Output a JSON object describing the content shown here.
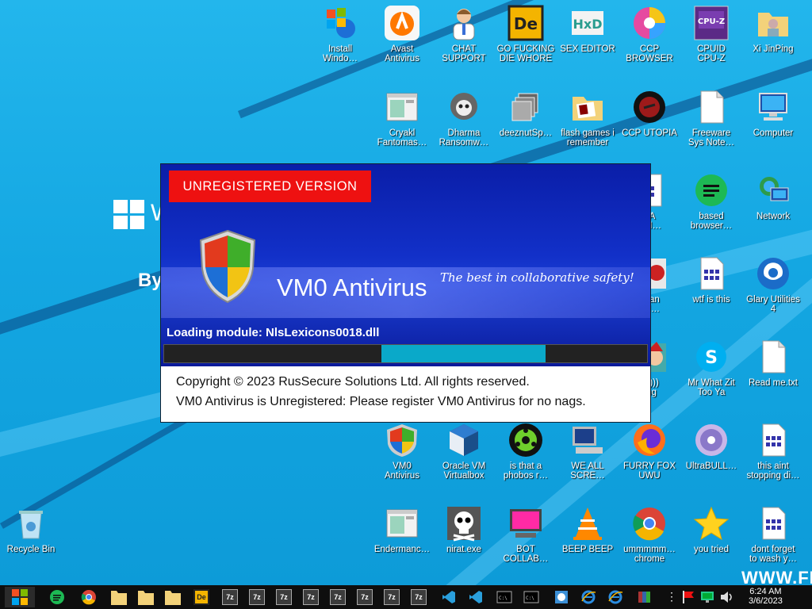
{
  "desktop": {
    "brand_letter": "W",
    "brand_by": "By",
    "url_text": "WWW.FR",
    "icons": [
      {
        "label": "Install\nWindo…",
        "icon": "windows-install-icon"
      },
      {
        "label": "Avast\nAntivirus",
        "icon": "avast-icon"
      },
      {
        "label": "CHAT\nSUPPORT",
        "icon": "chat-support-icon"
      },
      {
        "label": "GO FUCKING\nDIE WHORE",
        "icon": "de-app-icon"
      },
      {
        "label": "SEX EDITOR",
        "icon": "hxd-icon"
      },
      {
        "label": "CCP\nBROWSER",
        "icon": "ccp-browser-icon"
      },
      {
        "label": "CPUID\nCPU-Z",
        "icon": "cpuz-icon"
      },
      {
        "label": "Xi JinPing",
        "icon": "folder-user-icon"
      },
      {
        "label": "Cryakl\nFantomas…",
        "icon": "app-window-icon"
      },
      {
        "label": "Dharma\nRansomw…",
        "icon": "skull-helmet-icon"
      },
      {
        "label": "deeznutSp…",
        "icon": "stacked-pages-icon"
      },
      {
        "label": "flash games i\nremember",
        "icon": "folder-icon"
      },
      {
        "label": "CCP UTOPIA",
        "icon": "ccp-utopia-icon"
      },
      {
        "label": "Freeware\nSys Note…",
        "icon": "text-file-icon"
      },
      {
        "label": "Computer",
        "icon": "computer-icon"
      },
      {
        "label": "YA\nOM…",
        "icon": "doc-partial-icon"
      },
      {
        "label": "based\nbrowser…",
        "icon": "green-chat-icon"
      },
      {
        "label": "Network",
        "icon": "network-icon"
      },
      {
        "label": "ndan\ncid…",
        "icon": "red-app-icon"
      },
      {
        "label": "wtf is this",
        "icon": "ini-file-icon"
      },
      {
        "label": "Glary Utilities\n4",
        "icon": "glary-icon"
      },
      {
        "label": "ey)))\nling",
        "icon": "santa-icon"
      },
      {
        "label": "Mr What Zit\nToo Ya",
        "icon": "skype-icon"
      },
      {
        "label": "Read me.txt",
        "icon": "text-file-icon"
      },
      {
        "label": "VM0\nAntivirus",
        "icon": "shield-icon"
      },
      {
        "label": "Oracle VM\nVirtualbox",
        "icon": "virtualbox-icon"
      },
      {
        "label": "is that a\nphobos r…",
        "icon": "green-virus-icon"
      },
      {
        "label": "WE ALL\nSCRE…",
        "icon": "computer-old-icon"
      },
      {
        "label": "FURRY FOX\nUWU",
        "icon": "firefox-icon"
      },
      {
        "label": "UltraBULL…",
        "icon": "disc-icon"
      },
      {
        "label": "this aint\nstopping di…",
        "icon": "ini-file-icon"
      },
      {
        "label": "Recycle Bin",
        "icon": "recycle-bin-icon"
      },
      {
        "label": "Endermanc…",
        "icon": "app-window-icon"
      },
      {
        "label": "nirat.exe",
        "icon": "skull-icon"
      },
      {
        "label": "BOT\nCOLLAB…",
        "icon": "magenta-monitor-icon"
      },
      {
        "label": "BEEP BEEP",
        "icon": "vlc-icon"
      },
      {
        "label": "ummmmm…\nchrome",
        "icon": "chrome-icon"
      },
      {
        "label": "you tried",
        "icon": "star-icon"
      },
      {
        "label": "dont forget\nto wash y…",
        "icon": "ini-file-icon"
      }
    ]
  },
  "splash": {
    "badge": "UNREGISTERED VERSION",
    "product": "VM0 Antivirus",
    "tagline": "The best in collaborative safety!",
    "loading": "Loading module: NlsLexicons0018.dll",
    "progress_start": 0.45,
    "progress_end": 0.79,
    "copyright": "Copyright © 2023 RusSecure Solutions Ltd. All rights reserved.",
    "unregistered_note": "VM0 Antivirus is Unregistered: Please register VM0 Antivirus for no nags."
  },
  "taskbar": {
    "time": "6:24 AM",
    "date": "3/6/2023",
    "seven_zip_label": "7z",
    "de_label": "De",
    "items": [
      "start",
      "spotify",
      "chrome",
      "folder",
      "folder",
      "folder",
      "de",
      "7z",
      "7z",
      "7z",
      "7z",
      "7z",
      "7z",
      "7z",
      "7z",
      "vs-code",
      "vs-code",
      "cmd",
      "cmd",
      "ie-app",
      "ie",
      "ie",
      "winrar"
    ]
  },
  "colors": {
    "desktop": "#14a7e2",
    "badge": "#ee1111",
    "progress": "#0aa9c9",
    "splash": "#1230c8",
    "taskbar": "#0e0e0e"
  }
}
